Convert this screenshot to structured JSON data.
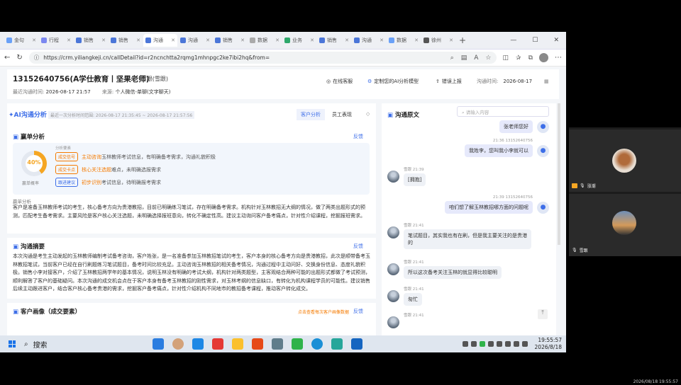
{
  "browser": {
    "tabs": [
      {
        "label": "金句",
        "color": "#6aa1f7"
      },
      {
        "label": "行程",
        "color": "#7b88f0"
      },
      {
        "label": "销售",
        "color": "#4b76d8"
      },
      {
        "label": "销售",
        "color": "#4b76d8"
      },
      {
        "label": "沟通",
        "color": "#4b76d8",
        "active": true
      },
      {
        "label": "沟通",
        "color": "#4b76d8"
      },
      {
        "label": "销售",
        "color": "#4b76d8"
      },
      {
        "label": "数据",
        "color": "#aaaaaa"
      },
      {
        "label": "业务",
        "color": "#2ea86b"
      },
      {
        "label": "销售",
        "color": "#4b76d8"
      },
      {
        "label": "沟通",
        "color": "#4b76d8"
      },
      {
        "label": "数据",
        "color": "#6aa1f7"
      },
      {
        "label": "徐州",
        "color": "#555555"
      }
    ],
    "url": "https://crm.yiliangkeji.cn/callDetail?id=r2ncnchtta2rqmg1mhnpgc2ke7ibi2hq&from="
  },
  "header": {
    "title": "13152640756(A学仕教育丨坚果老师)",
    "status": "雪跟(雪跟)",
    "last_label": "最近沟通时间:",
    "last_time": "2026-08-17 21:57",
    "source_label": "来源:",
    "source": "个人微信-单聊(文字聊天)",
    "online_service": "在线客服",
    "custom_model": "定制您的AI分析模型",
    "report": "错误上报",
    "comm_time_label": "沟通时间:",
    "comm_time": "2026-08-17"
  },
  "analysis": {
    "title": "AI沟通分析",
    "range": "最近一次分析时间范围: 2026-08-17 21:35:45 ~ 2026-08-17 21:57:56",
    "tab_customer": "客户分析",
    "tab_staff": "员工表现",
    "score_title": "赢单分析",
    "feedback": "反馈",
    "score_value": "40%",
    "score_label": "赢单概率",
    "tag_header": "分析要素",
    "tags": [
      {
        "label": "成交信号",
        "c": "#f57a00",
        "text_em": "主动咨询",
        "text": "玉林教师考试信息，有明确备考需求，沟通礼貌积极"
      },
      {
        "label": "成交卡点",
        "c": "#f57a00",
        "text_em": "核心关注选题",
        "text": "难点，未明确选报需求"
      },
      {
        "label": "跟进建议",
        "c": "#3d6ee8",
        "text_em": "初步识别",
        "text": "考试信息，待明确报考需求"
      }
    ],
    "subhead": "赢单分析",
    "score_para": "客户是准备玉林教师考试的考生，核心备考方向为贵港教招，目前已明确练习笔试，存在明确备考需求。机构针对玉林教招无大纲的情况，做了两类出题形式的预测，匹配考生备考需求。主要风险是客户核心关注选题，未明确选择报班意向，转化不确定性高。建议主动询问客户备考痛点，针对性介绍课程，挖掘报班需求。",
    "summary_title": "沟通摘要",
    "summary_para": "本次沟通是考生主动发起的玉林教师编制考试备考咨询，客户姓张，是一名准备参加玉林教招笔试的考生，客户本身的核心备考方向是贵港教招，此次是顺带备考玉林教招笔试，当前客户已经在自行刷题练习笔试题目，备考时间比较充足。主动咨询玉林教招的相关备考情况，沟通过程中主动问好、交换身份信息、态度礼貌积极。销售小李对接客户，介绍了玉林教招两学年的基本情况，说明玉林没有明确的考试大纲，机构针对两类题型，主客观结合两种可能的出题形式都做了考试预测，顺利解答了客户的基础疑问。本次沟通的成交机会点在于客户本身有备考玉林教招的刚性需求，对玉林考纲的信息缺口，有转化为机构课程学员的可能性。建议销售后续主动跟进客户，结合客户核心备考贵港的需求，挖掘客户备考痛点，针对性介绍机构不同地市的教招备考课程，推动客户转化成交。",
    "portrait_title": "客户画像（成交要素）",
    "portrait_link": "点击查看每次客户画像数据"
  },
  "chat": {
    "title": "沟通原文",
    "search_placeholder": "请输入内容",
    "messages": [
      {
        "side": "r",
        "meta": "",
        "text": "张老师您好"
      },
      {
        "side": "r",
        "meta": "21:36  13152640756",
        "text": "我姓李，您叫我小李就可以"
      },
      {
        "side": "l",
        "meta": "雪跟 21:39",
        "text": "[拥抱]"
      },
      {
        "side": "r",
        "meta": "21:39  13152640756",
        "text": "咱们想了解玉林教招哪方面的问题呢"
      },
      {
        "side": "l",
        "meta": "雪跟 21:41",
        "text": "笔试题目，其实我也有在刷，但是我主要关注的是贵港的"
      },
      {
        "side": "l",
        "meta": "雪跟 21:41",
        "text": "所以这次备考关注玉林的就显得比较聪明"
      },
      {
        "side": "l",
        "meta": "雪跟 21:41",
        "text": "匆忙"
      },
      {
        "side": "l",
        "meta": "雪跟 21:41",
        "text": ""
      }
    ]
  },
  "side": {
    "p1_name": "涨潮",
    "p2_name": "雪跟"
  },
  "taskbar": {
    "search": "搜索",
    "time": "19:55:57",
    "date": "2026/8/18"
  },
  "stamp": "2026/08/18 19:55:57"
}
